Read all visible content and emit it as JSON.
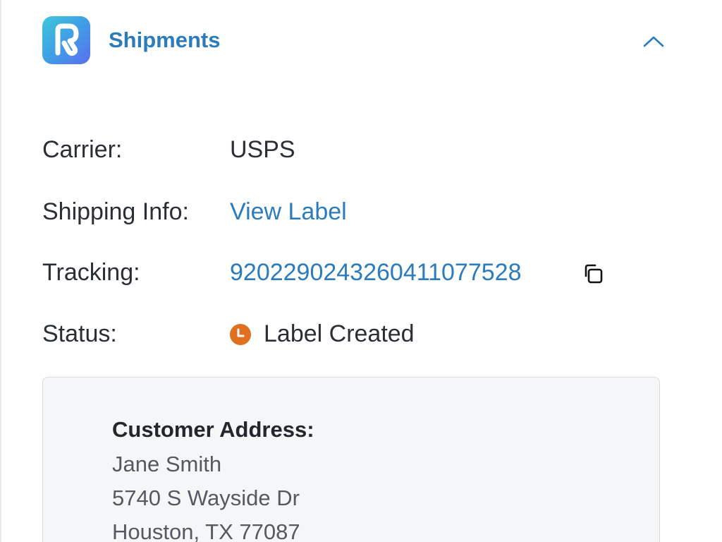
{
  "header": {
    "title": "Shipments",
    "logo_icon": "app-logo-r",
    "collapse_icon": "chevron-up-icon",
    "accent_color": "#2b7bbf"
  },
  "details": {
    "carrier": {
      "label": "Carrier:",
      "value": "USPS"
    },
    "shipping_info": {
      "label": "Shipping Info:",
      "value": "View Label"
    },
    "tracking": {
      "label": "Tracking:",
      "value": "9202290243260411077528",
      "icon": "copy-icon"
    },
    "status": {
      "label": "Status:",
      "value": "Label Created",
      "icon": "clock-icon",
      "color": "#e0701f"
    }
  },
  "address": {
    "heading": "Customer Address:",
    "lines": [
      "Jane Smith",
      "5740 S Wayside Dr",
      "Houston, TX 77087"
    ]
  }
}
